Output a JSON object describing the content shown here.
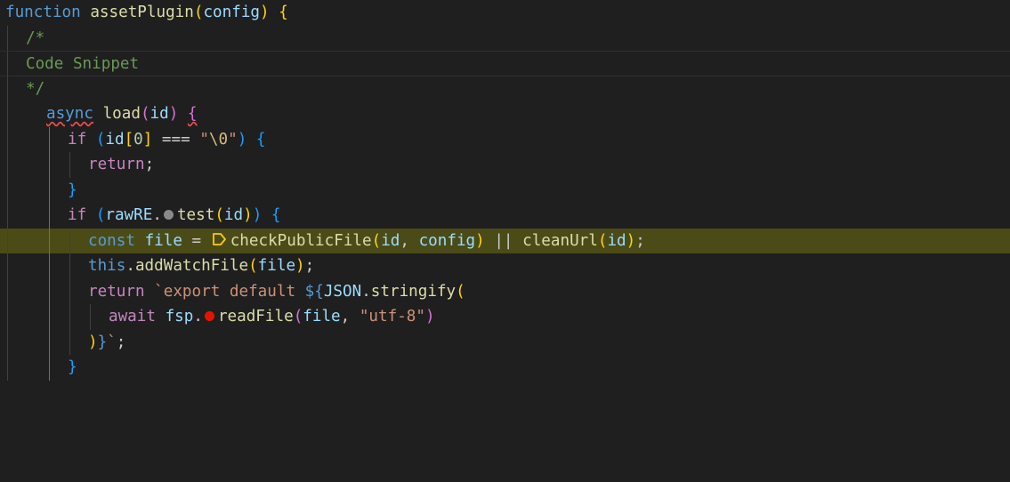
{
  "editor": {
    "colors": {
      "background": "#1f1f1f",
      "debug_line": "#4b4b18",
      "keyword": "#569cd6",
      "control": "#c586c0",
      "function": "#dcdcaa",
      "variable": "#9cdcfe",
      "string": "#ce9178",
      "comment": "#6a9955"
    },
    "lines": {
      "l1": {
        "kw": "function",
        "fn": "assetPlugin",
        "p1": "(",
        "param": "config",
        "p2": ")",
        "b": "{"
      },
      "l2": {
        "comment": "/*"
      },
      "l3": {
        "comment": "Code Snippet"
      },
      "l4": {
        "comment": "*/"
      },
      "l5": {
        "kw": "async",
        "fn": "load",
        "p1": "(",
        "param": "id",
        "p2": ")",
        "b": "{"
      },
      "l6": {
        "kw": "if",
        "p1": "(",
        "var": "id",
        "b1": "[",
        "num": "0",
        "b2": "]",
        "op": " === ",
        "str1": "\"",
        "esc": "\\0",
        "str2": "\"",
        "p2": ")",
        "b": "{"
      },
      "l7": {
        "kw": "return",
        "semi": ";"
      },
      "l8": {
        "b": "}"
      },
      "l9": {
        "kw": "if",
        "p1": "(",
        "var": "rawRE",
        "dotsep": ".",
        "fn": "test",
        "p2": "(",
        "arg": "id",
        "p3": ")",
        "p4": ")",
        "b": "{"
      },
      "l10": {
        "kw": "const",
        "var": "file",
        "op": " = ",
        "fn1": "checkPublicFile",
        "p1": "(",
        "a1": "id",
        "comma": ", ",
        "a2": "config",
        "p2": ")",
        "or": " || ",
        "fn2": "cleanUrl",
        "p3": "(",
        "a3": "id",
        "p4": ")",
        "semi": ";"
      },
      "l11": {
        "this": "this",
        "dot": ".",
        "fn": "addWatchFile",
        "p1": "(",
        "arg": "file",
        "p2": ")",
        "semi": ";"
      },
      "l12": {
        "kw": "return",
        "tick": " `",
        "str": "export default ",
        "tpl": "${",
        "var": "JSON",
        "dot": ".",
        "fn": "stringify",
        "p1": "("
      },
      "l13": {
        "kw": "await",
        "var": "fsp",
        "dotsep": ".",
        "fn": "readFile",
        "p1": "(",
        "arg": "file",
        "comma": ", ",
        "str": "\"utf-8\"",
        "p2": ")"
      },
      "l14": {
        "p1": ")",
        "tplend": "}",
        "tick": "`",
        "semi": ";"
      },
      "l15": {
        "b": "}"
      }
    }
  }
}
